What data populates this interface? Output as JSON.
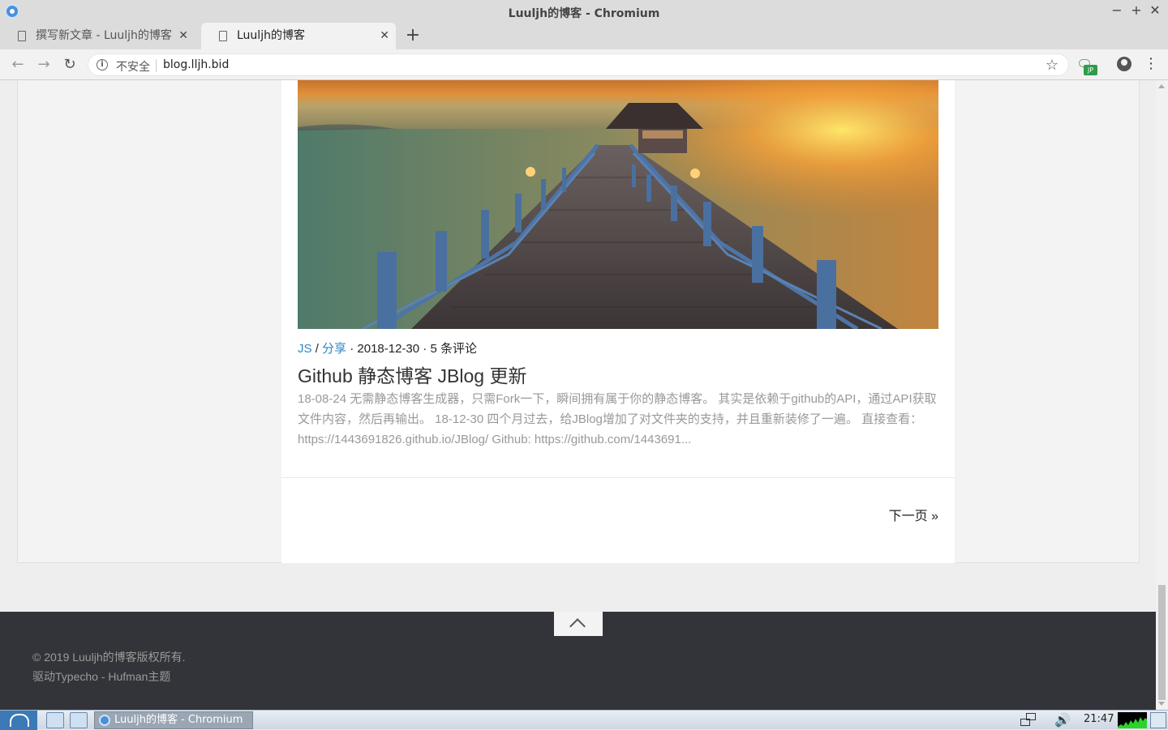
{
  "window": {
    "title": "Luuljh的博客 - Chromium"
  },
  "tabs": [
    {
      "label": "撰写新文章 - Luuljh的博客"
    },
    {
      "label": "Luuljh的博客"
    }
  ],
  "toolbar": {
    "security_label": "不安全",
    "url": "blog.lljh.bid",
    "extension_badge": "JP"
  },
  "post": {
    "tags": [
      "JS",
      "分享"
    ],
    "tag_separator": "/",
    "date": "2018-12-30",
    "comments": "5 条评论",
    "title": "Github 静态博客 JBlog 更新",
    "excerpt": "18-08-24 无需静态博客生成器，只需Fork一下，瞬间拥有属于你的静态博客。 其实是依赖于github的API，通过API获取文件内容，然后再输出。 18-12-30 四个月过去，给JBlog增加了对文件夹的支持，并且重新装修了一遍。 直接查看： https://1443691826.github.io/JBlog/ Github: https://github.com/1443691..."
  },
  "pagination": {
    "next_label": "下一页 »"
  },
  "footer": {
    "copyright": "© 2019 Luuljh的博客版权所有.",
    "powered": "驱动Typecho - Hufman主题"
  },
  "taskbar": {
    "task_label": "Luuljh的博客 - Chromium",
    "clock": "21:47"
  },
  "colors": {
    "link": "#2f86c0",
    "footer_bg": "#323439",
    "page_bg": "#eeeeee"
  }
}
